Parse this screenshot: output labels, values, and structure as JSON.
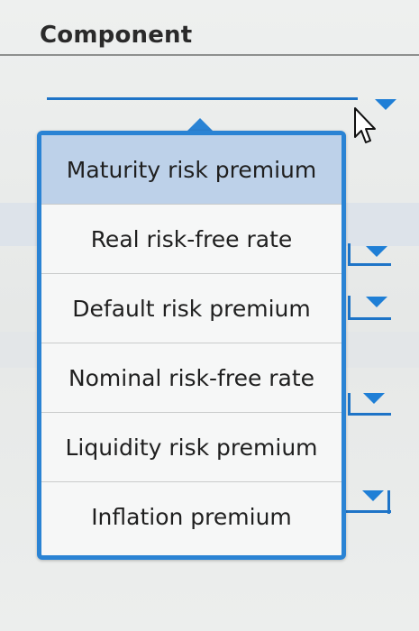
{
  "header": {
    "title": "Component"
  },
  "dropdown": {
    "options": [
      "Maturity risk premium",
      "Real risk-free rate",
      "Default risk premium",
      "Nominal risk-free rate",
      "Liquidity risk premium",
      "Inflation premium"
    ],
    "selected_index": 0
  },
  "colors": {
    "accent": "#2a83d4",
    "selected_bg": "#bdd1e9"
  },
  "icons": {
    "dropdown_arrow": "triangle-down",
    "cursor": "arrow-pointer"
  }
}
